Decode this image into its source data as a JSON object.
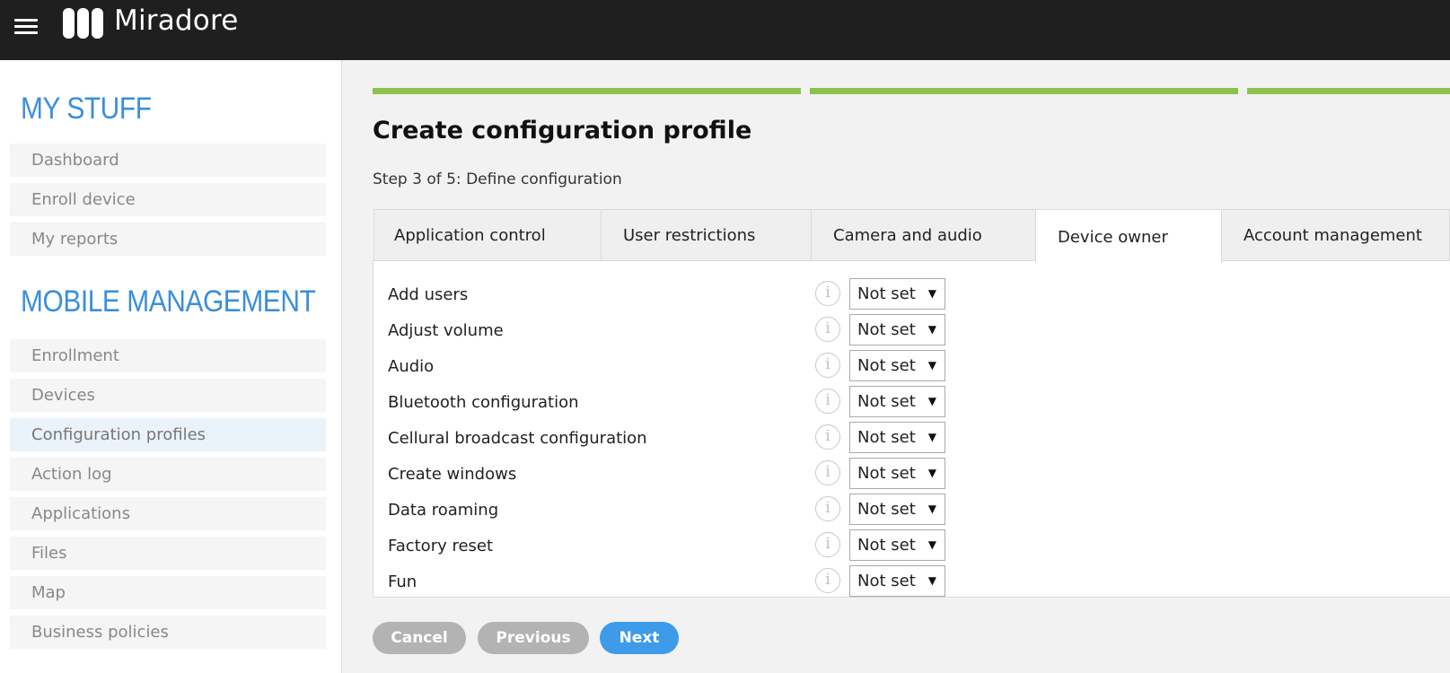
{
  "header": {
    "app_name": "Miradore",
    "menu_icon": "hamburger-menu-icon",
    "logo_icon": "miradore-logo-icon"
  },
  "sidebar": {
    "my_stuff": {
      "heading": "MY STUFF",
      "items": [
        {
          "label": "Dashboard"
        },
        {
          "label": "Enroll device"
        },
        {
          "label": "My reports"
        }
      ]
    },
    "mobile_management": {
      "heading": "MOBILE MANAGEMENT",
      "items": [
        {
          "label": "Enrollment"
        },
        {
          "label": "Devices"
        },
        {
          "label": "Configuration profiles",
          "active": true
        },
        {
          "label": "Action log"
        },
        {
          "label": "Applications"
        },
        {
          "label": "Files"
        },
        {
          "label": "Map"
        },
        {
          "label": "Business policies"
        }
      ]
    }
  },
  "main": {
    "title": "Create configuration profile",
    "step": "Step 3 of 5: Define configuration",
    "progress_completed_steps": 3,
    "tabs": [
      {
        "label": "Application control"
      },
      {
        "label": "User restrictions"
      },
      {
        "label": "Camera and audio"
      },
      {
        "label": "Device owner",
        "active": true
      },
      {
        "label": "Account management"
      }
    ],
    "settings": [
      {
        "label": "Add users",
        "value": "Not set"
      },
      {
        "label": "Adjust volume",
        "value": "Not set"
      },
      {
        "label": "Audio",
        "value": "Not set"
      },
      {
        "label": "Bluetooth configuration",
        "value": "Not set"
      },
      {
        "label": "Cellural broadcast configuration",
        "value": "Not set"
      },
      {
        "label": "Create windows",
        "value": "Not set"
      },
      {
        "label": "Data roaming",
        "value": "Not set"
      },
      {
        "label": "Factory reset",
        "value": "Not set"
      },
      {
        "label": "Fun",
        "value": "Not set"
      }
    ],
    "info_glyph": "i",
    "caret_glyph": "▼",
    "buttons": {
      "cancel": "Cancel",
      "previous": "Previous",
      "next": "Next"
    }
  },
  "colors": {
    "topbar": "#1f1f1f",
    "heading_blue": "#3a8fd9",
    "progress_green": "#8bc34a",
    "next_button": "#3d9be9",
    "grey_button": "#b3b3b3"
  }
}
